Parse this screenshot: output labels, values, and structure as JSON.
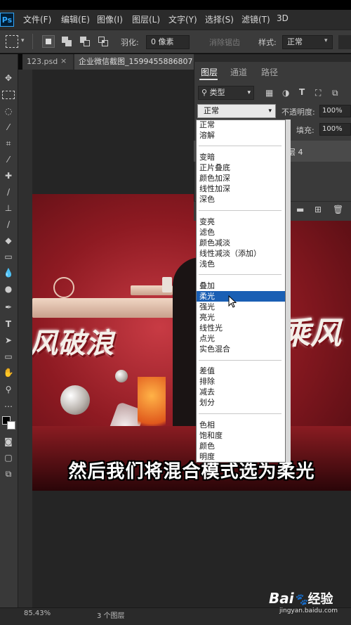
{
  "app": {
    "logo": "Ps"
  },
  "menu": [
    "文件(F)",
    "编辑(E)",
    "图像(I)",
    "图层(L)",
    "文字(Y)",
    "选择(S)",
    "滤镜(T)",
    "3D"
  ],
  "options": {
    "feather_label": "羽化:",
    "feather_value": "0 像素",
    "select_subject": "消除锯齿",
    "style_label": "样式:",
    "style_value": "正常"
  },
  "tabs": [
    "123.psd",
    "企业微信截图_1599455886807"
  ],
  "tab_close": "×",
  "layers_panel": {
    "tabs": [
      "图层",
      "通道",
      "路径"
    ],
    "filter_label": "类型",
    "blend_mode": "正常",
    "opacity_label": "不透明度:",
    "opacity_value": "100%",
    "fill_label": "填充:",
    "fill_value": "100%",
    "layer_fragment": "层 4"
  },
  "blend_modes": {
    "group1": [
      "正常",
      "溶解"
    ],
    "group2": [
      "变暗",
      "正片叠底",
      "颜色加深",
      "线性加深",
      "深色"
    ],
    "group3": [
      "变亮",
      "滤色",
      "颜色减淡",
      "线性减淡（添加）",
      "浅色"
    ],
    "group4": [
      "叠加",
      "柔光",
      "强光",
      "亮光",
      "线性光",
      "点光",
      "实色混合"
    ],
    "group5": [
      "差值",
      "排除",
      "减去",
      "划分"
    ],
    "group6": [
      "色相",
      "饱和度",
      "颜色",
      "明度"
    ],
    "highlighted": "柔光"
  },
  "artwork": {
    "left_text": "风破浪",
    "right_text": "乘风"
  },
  "subtitle": "然后我们将混合模式选为柔光",
  "status": {
    "zoom": "85.43%",
    "layers": "3 个图层"
  },
  "watermark": {
    "brand": "Bai",
    "paw": "du",
    "suffix": "经验",
    "url": "jingyan.baidu.com"
  },
  "colors": {
    "highlight": "#1a5fb4",
    "ps_blue": "#31a8ff"
  }
}
